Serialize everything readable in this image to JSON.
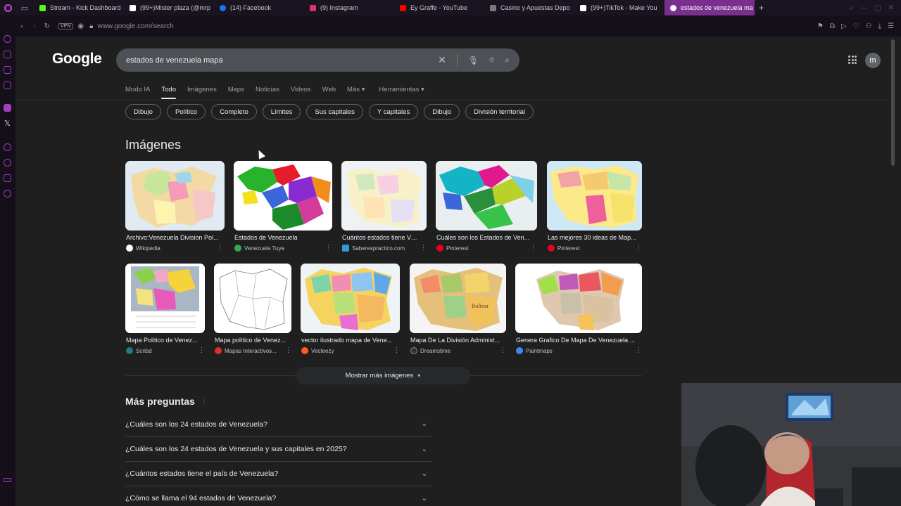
{
  "browser": {
    "tabs": [
      {
        "label": "Stream - Kick Dashboard",
        "color": "#53fc18"
      },
      {
        "label": "(99+)Mister plaza (@mrp",
        "color": "#ffffff"
      },
      {
        "label": "(14) Facebook",
        "color": "#1877f2"
      },
      {
        "label": "(9) Instagram",
        "color": "#e1306c"
      },
      {
        "label": "Ey Graffe - YouTube",
        "color": "#ff0000"
      },
      {
        "label": "Casino y Apuestas Depo",
        "color": "#7a7a7a"
      },
      {
        "label": "(99+)TikTok - Make You",
        "color": "#ffffff"
      },
      {
        "label": "estados de venezuela ma",
        "color": "#ffffff",
        "active": true
      }
    ],
    "vpn": "VPN",
    "url": "www.google.com/search"
  },
  "google": {
    "logo": "Google",
    "query": "estados de venezuela mapa",
    "avatar": "m",
    "tabs": [
      "Modo IA",
      "Todo",
      "Imágenes",
      "Maps",
      "Noticias",
      "Videos",
      "Web",
      "Más ▾",
      "Herramientas ▾"
    ],
    "active_tab": "Todo",
    "chips": [
      "Dibujo",
      "Político",
      "Completo",
      "Límites",
      "Sus capitales",
      "Y capitales",
      "Dibujo",
      "División territorial"
    ],
    "images_heading": "Imágenes",
    "images_row1": [
      {
        "caption": "Archivo:Venezuela Division Pol...",
        "source": "Wikipedia",
        "fav": "#ffffff"
      },
      {
        "caption": "Estados de Venezuela",
        "source": "Venezuela Tuya",
        "fav": "#34a853"
      },
      {
        "caption": "Cuántos estados tiene Ve...",
        "source": "Saberespractico.com",
        "fav": "#2d9cdb"
      },
      {
        "caption": "Cuáles son los Estados de Ven...",
        "source": "Pinterest",
        "fav": "#e60023"
      },
      {
        "caption": "Las mejores 30 ideas de Map...",
        "source": "Pinterest",
        "fav": "#e60023"
      }
    ],
    "images_row2": [
      {
        "caption": "Mapa Politico de Venez...",
        "source": "Scribd",
        "fav": "#1e7b85"
      },
      {
        "caption": "Mapa político de Venez...",
        "source": "Mapas Interactivos...",
        "fav": "#d93025"
      },
      {
        "caption": "vector ilustrado mapa de Vene...",
        "source": "Vecteezy",
        "fav": "#ff5a1f"
      },
      {
        "caption": "Mapa De La División Administ...",
        "source": "Dreamstime",
        "fav": "#333333"
      },
      {
        "caption": "Genera Grafico De Mapa De Venezuela ...",
        "source": "Paintmaps",
        "fav": "#4285f4"
      }
    ],
    "map_label_bolivar": "Bolívar",
    "show_more": "Mostrar más imágenes",
    "paa_title": "Más preguntas",
    "questions": [
      "¿Cuáles son los 24 estados de Venezuela?",
      "¿Cuáles son los 24 estados de Venezuela y sus capitales en 2025?",
      "¿Cuántos estados tiene el país de Venezuela?",
      "¿Cómo se llama el 94 estados de Venezuela?"
    ]
  },
  "icons": [
    "close-icon",
    "mic-icon",
    "lens-icon",
    "search-icon",
    "apps-icon",
    "chevron-down-icon",
    "more-vert-icon"
  ]
}
